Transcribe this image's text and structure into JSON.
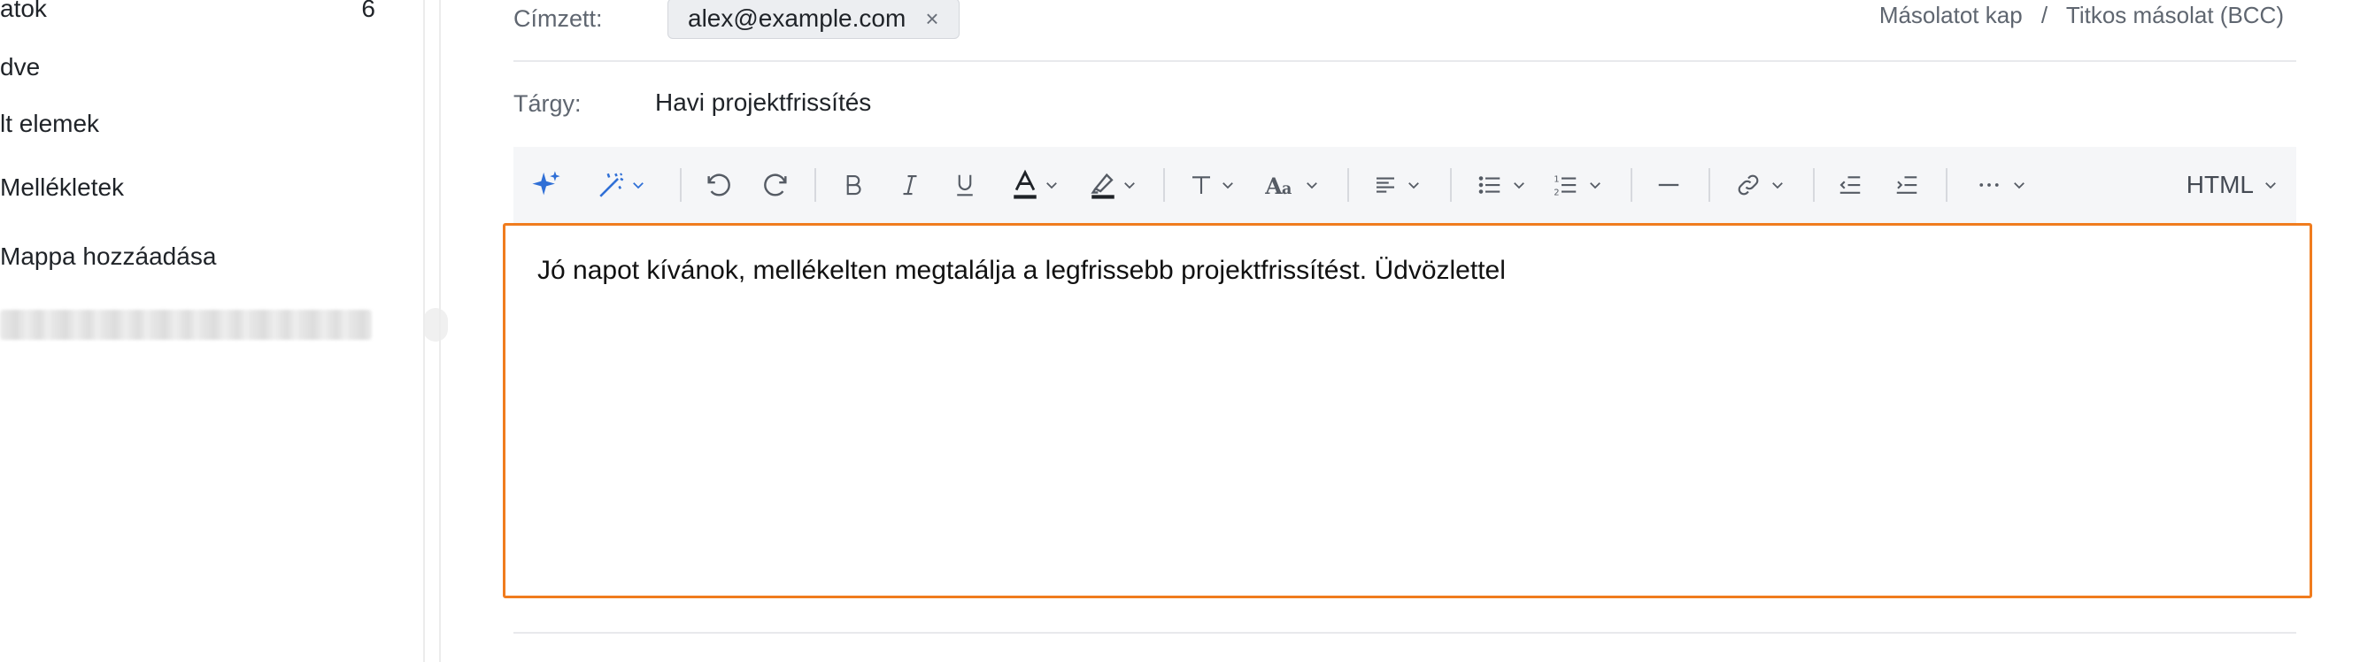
{
  "sidebar": {
    "items": [
      {
        "label": "atok",
        "count": "6"
      },
      {
        "label": "dve"
      },
      {
        "label": "lt elemek"
      },
      {
        "label": "Mellékletek"
      },
      {
        "label": "Mappa hozzáadása"
      }
    ]
  },
  "compose": {
    "to_label": "Címzett:",
    "recipient": "alex@example.com",
    "remove_glyph": "×",
    "cc_label": "Másolatot kap",
    "separator": "/",
    "bcc_label": "Titkos másolat (BCC)",
    "subject_label": "Tárgy:",
    "subject": "Havi projektfrissítés",
    "body": "Jó napot kívánok, mellékelten megtalálja a legfrissebb projektfrissítést. Üdvözlettel"
  },
  "toolbar": {
    "format_label": "HTML",
    "icons": [
      "ai-sparkle-icon",
      "magic-wand-icon",
      "undo-icon",
      "redo-icon",
      "bold-icon",
      "italic-icon",
      "underline-icon",
      "font-color-icon",
      "highlight-icon",
      "text-size-icon",
      "font-family-icon",
      "align-icon",
      "bullet-list-icon",
      "numbered-list-icon",
      "horizontal-rule-icon",
      "link-icon",
      "outdent-icon",
      "indent-icon",
      "more-icon"
    ]
  },
  "colors": {
    "accent_blue": "#2f6fd6",
    "focus_orange": "#f07c1e",
    "font_color_bar": "#1f2328"
  }
}
